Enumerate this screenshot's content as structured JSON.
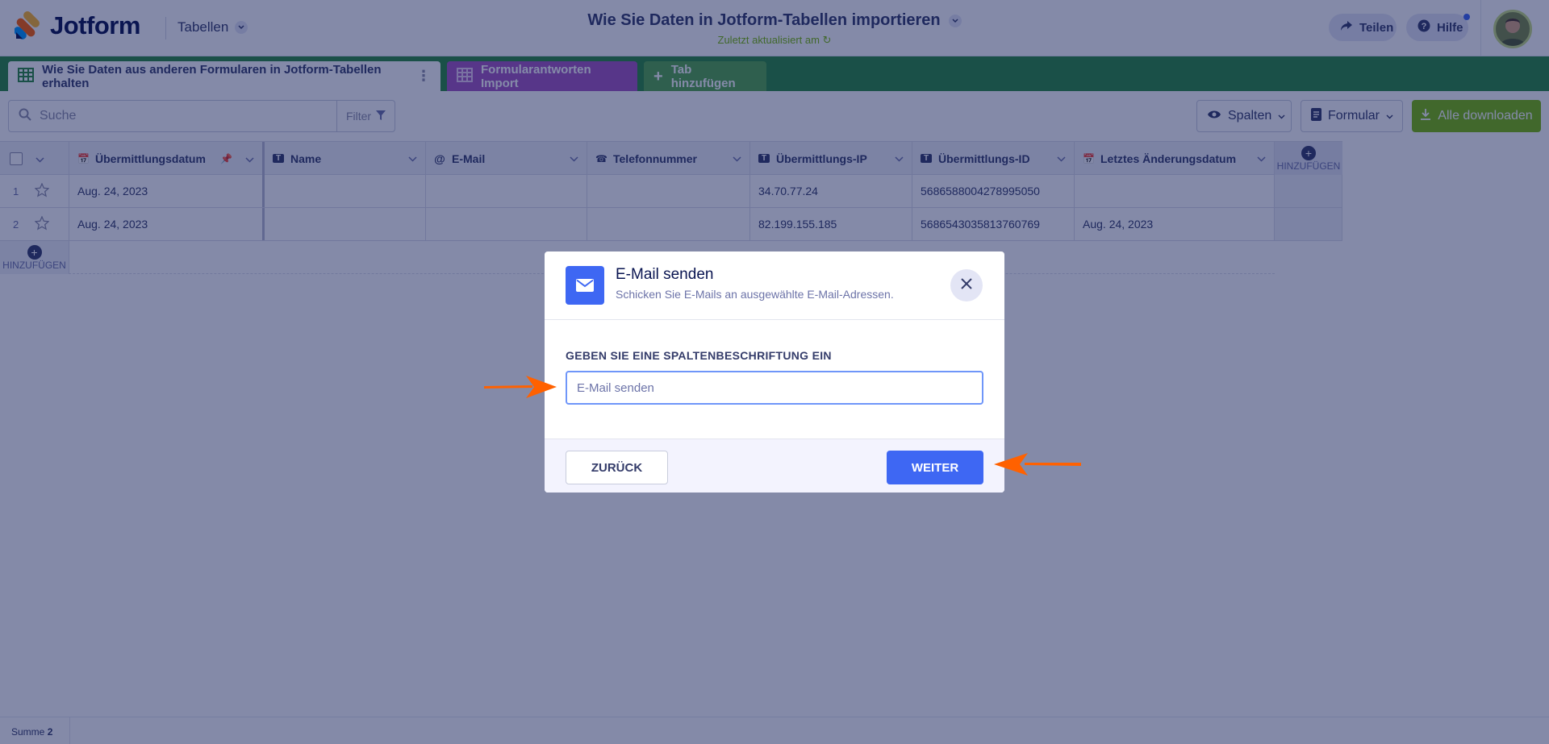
{
  "header": {
    "logo_text": "Jotform",
    "app_switcher": "Tabellen",
    "title": "Wie Sie Daten in Jotform-Tabellen importieren",
    "subtitle": "Zuletzt aktualisiert am",
    "share_label": "Teilen",
    "help_label": "Hilfe"
  },
  "tabs": [
    {
      "label": "Wie Sie Daten aus anderen Formularen in Jotform-Tabellen erhalten"
    },
    {
      "label": "Formularantworten Import"
    },
    {
      "label": "Tab hinzufügen"
    }
  ],
  "toolbar": {
    "search_placeholder": "Suche",
    "filter_label": "Filter",
    "columns_label": "Spalten",
    "form_label": "Formular",
    "download_label": "Alle downloaden"
  },
  "table": {
    "columns": [
      "Übermittlungsdatum",
      "Name",
      "E-Mail",
      "Telefonnummer",
      "Übermittlungs-IP",
      "Übermittlungs-ID",
      "Letztes Änderungsdatum"
    ],
    "add_column_label": "HINZUFÜGEN",
    "add_row_label": "HINZUFÜGEN",
    "rows": [
      {
        "num": "1",
        "cells": [
          "Aug. 24, 2023",
          "",
          "",
          "",
          "34.70.77.24",
          "5686588004278995050",
          ""
        ]
      },
      {
        "num": "2",
        "cells": [
          "Aug. 24, 2023",
          "",
          "",
          "",
          "82.199.155.185",
          "5686543035813760769",
          "Aug. 24, 2023"
        ]
      }
    ]
  },
  "footer": {
    "sum_label": "Summe",
    "sum_value": "2"
  },
  "modal": {
    "title": "E-Mail senden",
    "subtitle": "Schicken Sie E-Mails an ausgewählte E-Mail-Adressen.",
    "field_label": "GEBEN SIE EINE SPALTENBESCHRIFTUNG EIN",
    "field_placeholder": "E-Mail senden",
    "back_label": "ZURÜCK",
    "next_label": "WEITER"
  },
  "colors": {
    "brand_green": "#2b8a3e",
    "accent_blue": "#3e67f3",
    "annotation_orange": "#ff6100"
  }
}
